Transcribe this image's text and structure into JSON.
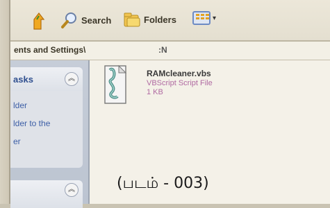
{
  "toolbar": {
    "up_icon": "up-arrow-icon",
    "search_label": "Search",
    "folders_label": "Folders",
    "views_icon": "views-icon"
  },
  "addressbar": {
    "path_fragment": "ents and Settings\\",
    "path_tail": ":N"
  },
  "taskpane": {
    "section1_title": "asks",
    "links": [
      "lder",
      "lder to the",
      "er"
    ]
  },
  "file": {
    "name": "RAMcleaner.vbs",
    "type": "VBScript Script File",
    "size": "1 KB",
    "icon": "vbscript-file-icon"
  },
  "caption": "(படம் - 003)"
}
